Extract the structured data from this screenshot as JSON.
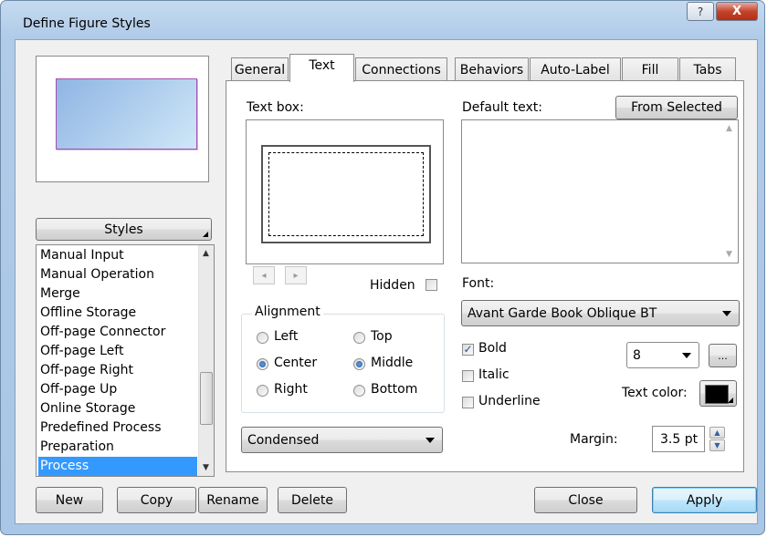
{
  "window": {
    "title": "Define Figure Styles",
    "help_glyph": "?",
    "close_glyph": "X"
  },
  "left": {
    "styles_button": "Styles",
    "list": [
      "Manual Input",
      "Manual Operation",
      "Merge",
      "Offline Storage",
      "Off-page Connector",
      "Off-page Left",
      "Off-page Right",
      "Off-page Up",
      "Online Storage",
      "Predefined Process",
      "Preparation",
      "Process"
    ],
    "selected_item": "Process"
  },
  "tabs": [
    "General",
    "Text",
    "Connections",
    "Behaviors",
    "Auto-Label",
    "Fill",
    "Tabs"
  ],
  "active_tab": "Text",
  "text_tab": {
    "textbox_label": "Text box:",
    "hidden_label": "Hidden",
    "hidden_checked": false,
    "alignment": {
      "title": "Alignment",
      "horizontal": [
        "Left",
        "Center",
        "Right"
      ],
      "vertical": [
        "Top",
        "Middle",
        "Bottom"
      ],
      "selected_horizontal": "Center",
      "selected_vertical": "Middle"
    },
    "spacing_value": "Condensed",
    "default_text_label": "Default text:",
    "from_selected_button": "From Selected",
    "font_label": "Font:",
    "font_value": "Avant Garde Book Oblique BT",
    "bold_label": "Bold",
    "bold_checked": true,
    "italic_label": "Italic",
    "italic_checked": false,
    "underline_label": "Underline",
    "underline_checked": false,
    "font_size": "8",
    "more_button": "...",
    "text_color_label": "Text color:",
    "text_color": "#000000",
    "margin_label": "Margin:",
    "margin_value": "3.5 pt"
  },
  "footer": {
    "new": "New",
    "copy": "Copy",
    "rename": "Rename",
    "delete": "Delete",
    "close": "Close",
    "apply": "Apply"
  },
  "colors": {
    "selection": "#3399ff",
    "preview_border": "#a54fb1",
    "preview_fill": "#8fb5e4"
  }
}
